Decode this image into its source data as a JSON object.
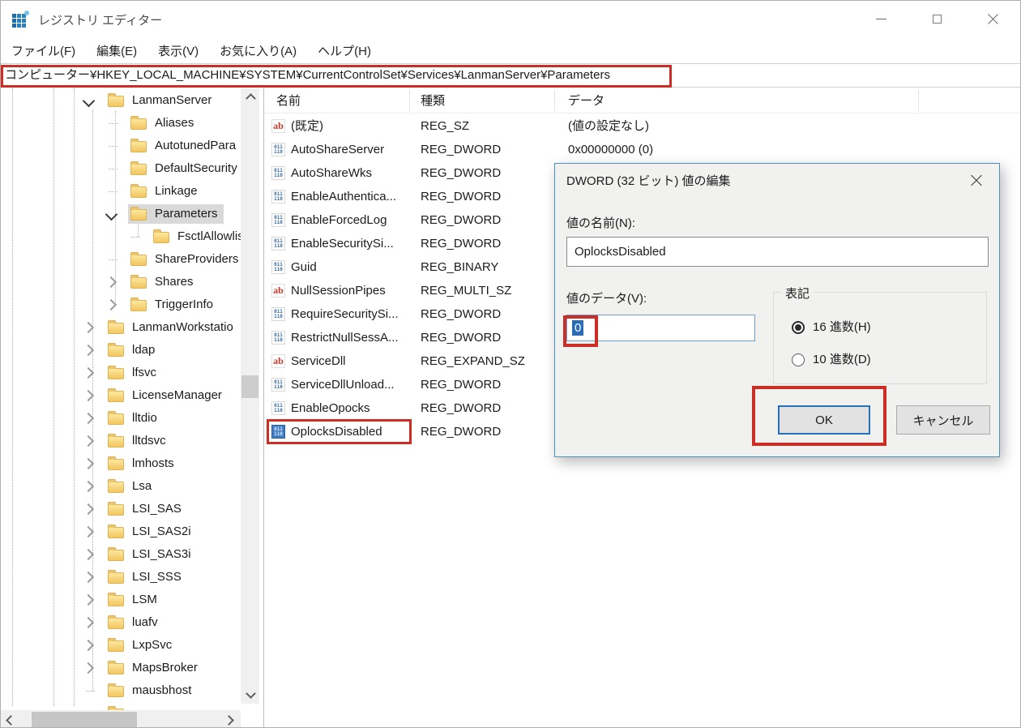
{
  "window": {
    "title": "レジストリ エディター"
  },
  "menu": {
    "items": [
      "ファイル(F)",
      "編集(E)",
      "表示(V)",
      "お気に入り(A)",
      "ヘルプ(H)"
    ]
  },
  "address_bar": {
    "value": "コンピューター¥HKEY_LOCAL_MACHINE¥SYSTEM¥CurrentControlSet¥Services¥LanmanServer¥Parameters"
  },
  "tree": {
    "items": [
      {
        "label": "LanmanServer",
        "level": 3,
        "expander": "expanded",
        "selected": false
      },
      {
        "label": "Aliases",
        "level": 4,
        "expander": "none",
        "selected": false
      },
      {
        "label": "AutotunedPara",
        "level": 4,
        "expander": "none",
        "selected": false
      },
      {
        "label": "DefaultSecurity",
        "level": 4,
        "expander": "none",
        "selected": false
      },
      {
        "label": "Linkage",
        "level": 4,
        "expander": "none",
        "selected": false
      },
      {
        "label": "Parameters",
        "level": 4,
        "expander": "expanded",
        "selected": true
      },
      {
        "label": "FsctlAllowlis",
        "level": 5,
        "expander": "none",
        "selected": false
      },
      {
        "label": "ShareProviders",
        "level": 4,
        "expander": "none",
        "selected": false
      },
      {
        "label": "Shares",
        "level": 4,
        "expander": "collapsed",
        "selected": false
      },
      {
        "label": "TriggerInfo",
        "level": 4,
        "expander": "collapsed",
        "selected": false
      },
      {
        "label": "LanmanWorkstatio",
        "level": 3,
        "expander": "collapsed",
        "selected": false
      },
      {
        "label": "ldap",
        "level": 3,
        "expander": "collapsed",
        "selected": false
      },
      {
        "label": "lfsvc",
        "level": 3,
        "expander": "collapsed",
        "selected": false
      },
      {
        "label": "LicenseManager",
        "level": 3,
        "expander": "collapsed",
        "selected": false
      },
      {
        "label": "lltdio",
        "level": 3,
        "expander": "collapsed",
        "selected": false
      },
      {
        "label": "lltdsvc",
        "level": 3,
        "expander": "collapsed",
        "selected": false
      },
      {
        "label": "lmhosts",
        "level": 3,
        "expander": "collapsed",
        "selected": false
      },
      {
        "label": "Lsa",
        "level": 3,
        "expander": "collapsed",
        "selected": false
      },
      {
        "label": "LSI_SAS",
        "level": 3,
        "expander": "collapsed",
        "selected": false
      },
      {
        "label": "LSI_SAS2i",
        "level": 3,
        "expander": "collapsed",
        "selected": false
      },
      {
        "label": "LSI_SAS3i",
        "level": 3,
        "expander": "collapsed",
        "selected": false
      },
      {
        "label": "LSI_SSS",
        "level": 3,
        "expander": "collapsed",
        "selected": false
      },
      {
        "label": "LSM",
        "level": 3,
        "expander": "collapsed",
        "selected": false
      },
      {
        "label": "luafv",
        "level": 3,
        "expander": "collapsed",
        "selected": false
      },
      {
        "label": "LxpSvc",
        "level": 3,
        "expander": "collapsed",
        "selected": false
      },
      {
        "label": "MapsBroker",
        "level": 3,
        "expander": "collapsed",
        "selected": false
      },
      {
        "label": "mausbhost",
        "level": 3,
        "expander": "none",
        "selected": false
      },
      {
        "label": "",
        "level": 3,
        "expander": "none",
        "selected": false
      }
    ]
  },
  "list": {
    "columns": [
      "名前",
      "種類",
      "データ"
    ],
    "icon_glyphs": {
      "string": "ab",
      "dword_top": "011",
      "dword_bottom": "110"
    },
    "rows": [
      {
        "name": "(既定)",
        "type": "REG_SZ",
        "data": "(値の設定なし)",
        "icon": "string",
        "selected": false
      },
      {
        "name": "AutoShareServer",
        "type": "REG_DWORD",
        "data": "0x00000000 (0)",
        "icon": "dword",
        "selected": false
      },
      {
        "name": "AutoShareWks",
        "type": "REG_DWORD",
        "data": "",
        "icon": "dword",
        "selected": false
      },
      {
        "name": "EnableAuthentica...",
        "type": "REG_DWORD",
        "data": "",
        "icon": "dword",
        "selected": false
      },
      {
        "name": "EnableForcedLog",
        "type": "REG_DWORD",
        "data": "",
        "icon": "dword",
        "selected": false
      },
      {
        "name": "EnableSecuritySi...",
        "type": "REG_DWORD",
        "data": "",
        "icon": "dword",
        "selected": false
      },
      {
        "name": "Guid",
        "type": "REG_BINARY",
        "data": "",
        "icon": "dword",
        "selected": false
      },
      {
        "name": "NullSessionPipes",
        "type": "REG_MULTI_SZ",
        "data": "",
        "icon": "string",
        "selected": false
      },
      {
        "name": "RequireSecuritySi...",
        "type": "REG_DWORD",
        "data": "",
        "icon": "dword",
        "selected": false
      },
      {
        "name": "RestrictNullSessA...",
        "type": "REG_DWORD",
        "data": "",
        "icon": "dword",
        "selected": false
      },
      {
        "name": "ServiceDll",
        "type": "REG_EXPAND_SZ",
        "data": "",
        "icon": "string",
        "selected": false
      },
      {
        "name": "ServiceDllUnload...",
        "type": "REG_DWORD",
        "data": "",
        "icon": "dword",
        "selected": false
      },
      {
        "name": "EnableOpocks",
        "type": "REG_DWORD",
        "data": "",
        "icon": "dword",
        "selected": false
      },
      {
        "name": "OplocksDisabled",
        "type": "REG_DWORD",
        "data": "",
        "icon": "dword",
        "selected": true
      }
    ]
  },
  "dialog": {
    "title": "DWORD (32 ビット) 値の編集",
    "value_name_label": "値の名前(N):",
    "value_name": "OplocksDisabled",
    "value_data_label": "値のデータ(V):",
    "value_data": "0",
    "base_group_label": "表記",
    "radio_hex_label": "16 進数(H)",
    "radio_dec_label": "10 進数(D)",
    "radio_selected": "hex",
    "ok_label": "OK",
    "cancel_label": "キャンセル"
  },
  "colors": {
    "annotation_red": "#cc2d25",
    "dialog_border_blue": "#4a90c0",
    "selection_blue": "#2a6db5",
    "default_button_border": "#2670b8"
  }
}
